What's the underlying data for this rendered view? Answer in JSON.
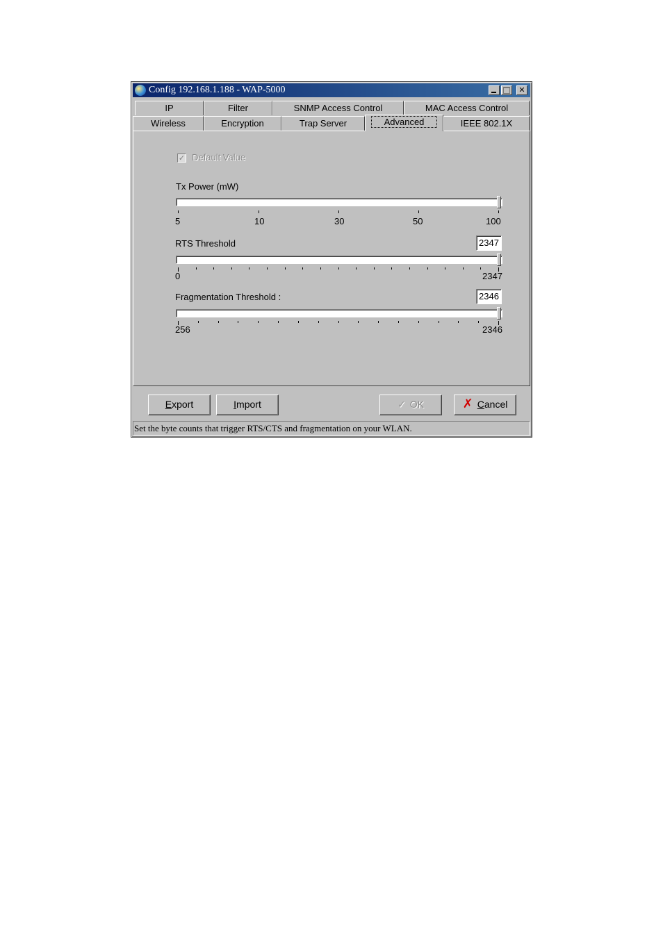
{
  "window": {
    "title": "Config 192.168.1.188 - WAP-5000",
    "controls": [
      "minimize",
      "maximize",
      "close"
    ]
  },
  "tabs": {
    "row1": [
      "IP",
      "Filter",
      "SNMP Access Control",
      "MAC Access Control"
    ],
    "row2": [
      "Wireless",
      "Encryption",
      "Trap Server",
      "Advanced",
      "IEEE 802.1X"
    ],
    "selected": "Advanced"
  },
  "advanced": {
    "default_value": {
      "label": "Default Value",
      "checked": true,
      "enabled": false
    },
    "tx_power": {
      "label": "Tx Power (mW)",
      "tick_labels": [
        "5",
        "10",
        "30",
        "50",
        "100"
      ],
      "value": "100"
    },
    "rts_threshold": {
      "label": "RTS Threshold",
      "value": "2347",
      "min_label": "0",
      "max_label": "2347"
    },
    "fragmentation_threshold": {
      "label": "Fragmentation Threshold :",
      "value": "2346",
      "min_label": "256",
      "max_label": "2346"
    }
  },
  "buttons": {
    "export": {
      "prefix": "",
      "mnemonic": "E",
      "rest": "xport"
    },
    "import": {
      "prefix": "",
      "mnemonic": "I",
      "rest": "mport"
    },
    "ok": {
      "label": "OK",
      "enabled": false
    },
    "cancel": {
      "prefix": "",
      "mnemonic": "C",
      "rest": "ancel"
    }
  },
  "status_text": "Set the byte counts that trigger RTS/CTS and fragmentation on your WLAN.",
  "icons": {
    "app": "globe-icon",
    "ok": "checkmark-icon",
    "cancel": "red-x-icon"
  }
}
